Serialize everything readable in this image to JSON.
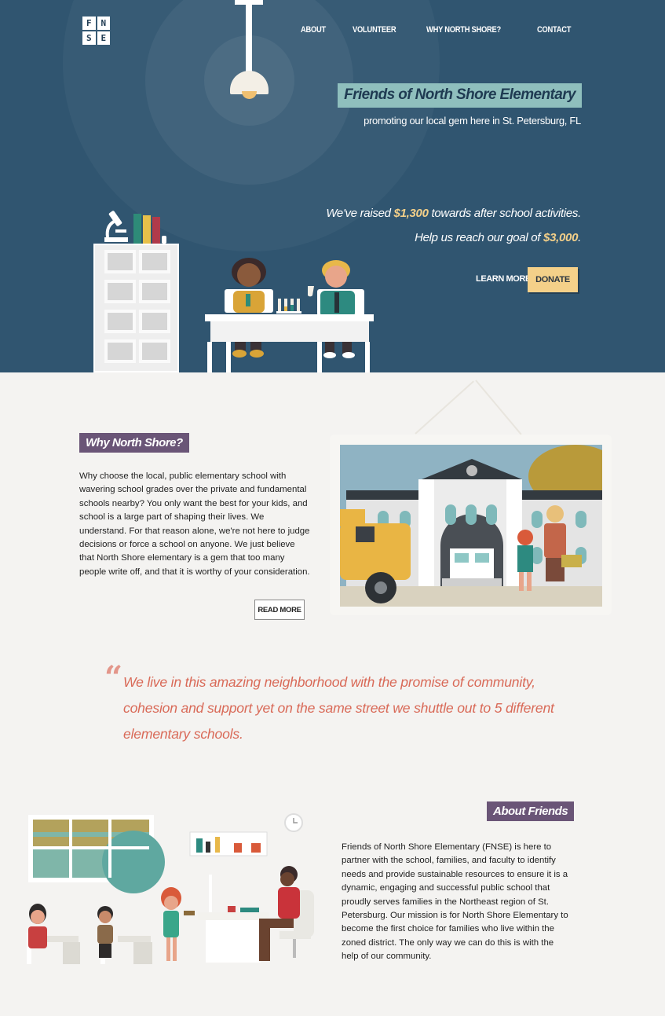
{
  "logo": {
    "letters": [
      "F",
      "N",
      "S",
      "E"
    ]
  },
  "nav": {
    "items": [
      {
        "label": "ABOUT"
      },
      {
        "label": "VOLUNTEER"
      },
      {
        "label": "WHY NORTH SHORE?"
      },
      {
        "label": "CONTACT"
      }
    ]
  },
  "hero": {
    "title": "Friends of North Shore Elementary",
    "subtitle": "promoting our local gem here in St. Petersburg, FL",
    "raised_prefix": "We've raised ",
    "raised_amount": "$1,300",
    "raised_suffix": " towards after school activities.",
    "goal_prefix": "Help us reach our goal of ",
    "goal_amount": "$3,000",
    "goal_suffix": ".",
    "learn_more_label": "LEARN MORE",
    "donate_label": "DONATE"
  },
  "why": {
    "label": "Why North Shore?",
    "text": "Why choose the local, public elementary school with wavering school grades over the private and fundamental schools nearby? You only want the best for your kids, and school is a large part of shaping their lives. We understand. For that reason alone, we're not here to judge decisions or force a school on anyone. We just believe that North Shore elementary is a gem that too many people write off, and that it is worthy of your consideration.",
    "read_more_label": "READ MORE"
  },
  "quote": {
    "mark": "“",
    "text": "We live in this amazing neighborhood with the promise of community, cohesion and support yet on the same street we shuttle out to 5 different elementary schools."
  },
  "about": {
    "label": "About Friends",
    "text": "Friends of North Shore Elementary (FNSE) is here to partner with the school, families, and faculty to identify needs and provide sustainable resources to ensure it is a dynamic, engaging and successful public school that proudly serves families in the Northeast region of St. Petersburg. Our mission is for North Shore Elementary to become the first choice for families who live within the zoned district. The only way we can do this is with the help of our community."
  },
  "colors": {
    "hero_bg": "#305570",
    "accent_teal": "#8fbfbd",
    "accent_gold": "#f4d089",
    "label_purple": "#6a5577",
    "quote_coral": "#d96a58"
  }
}
